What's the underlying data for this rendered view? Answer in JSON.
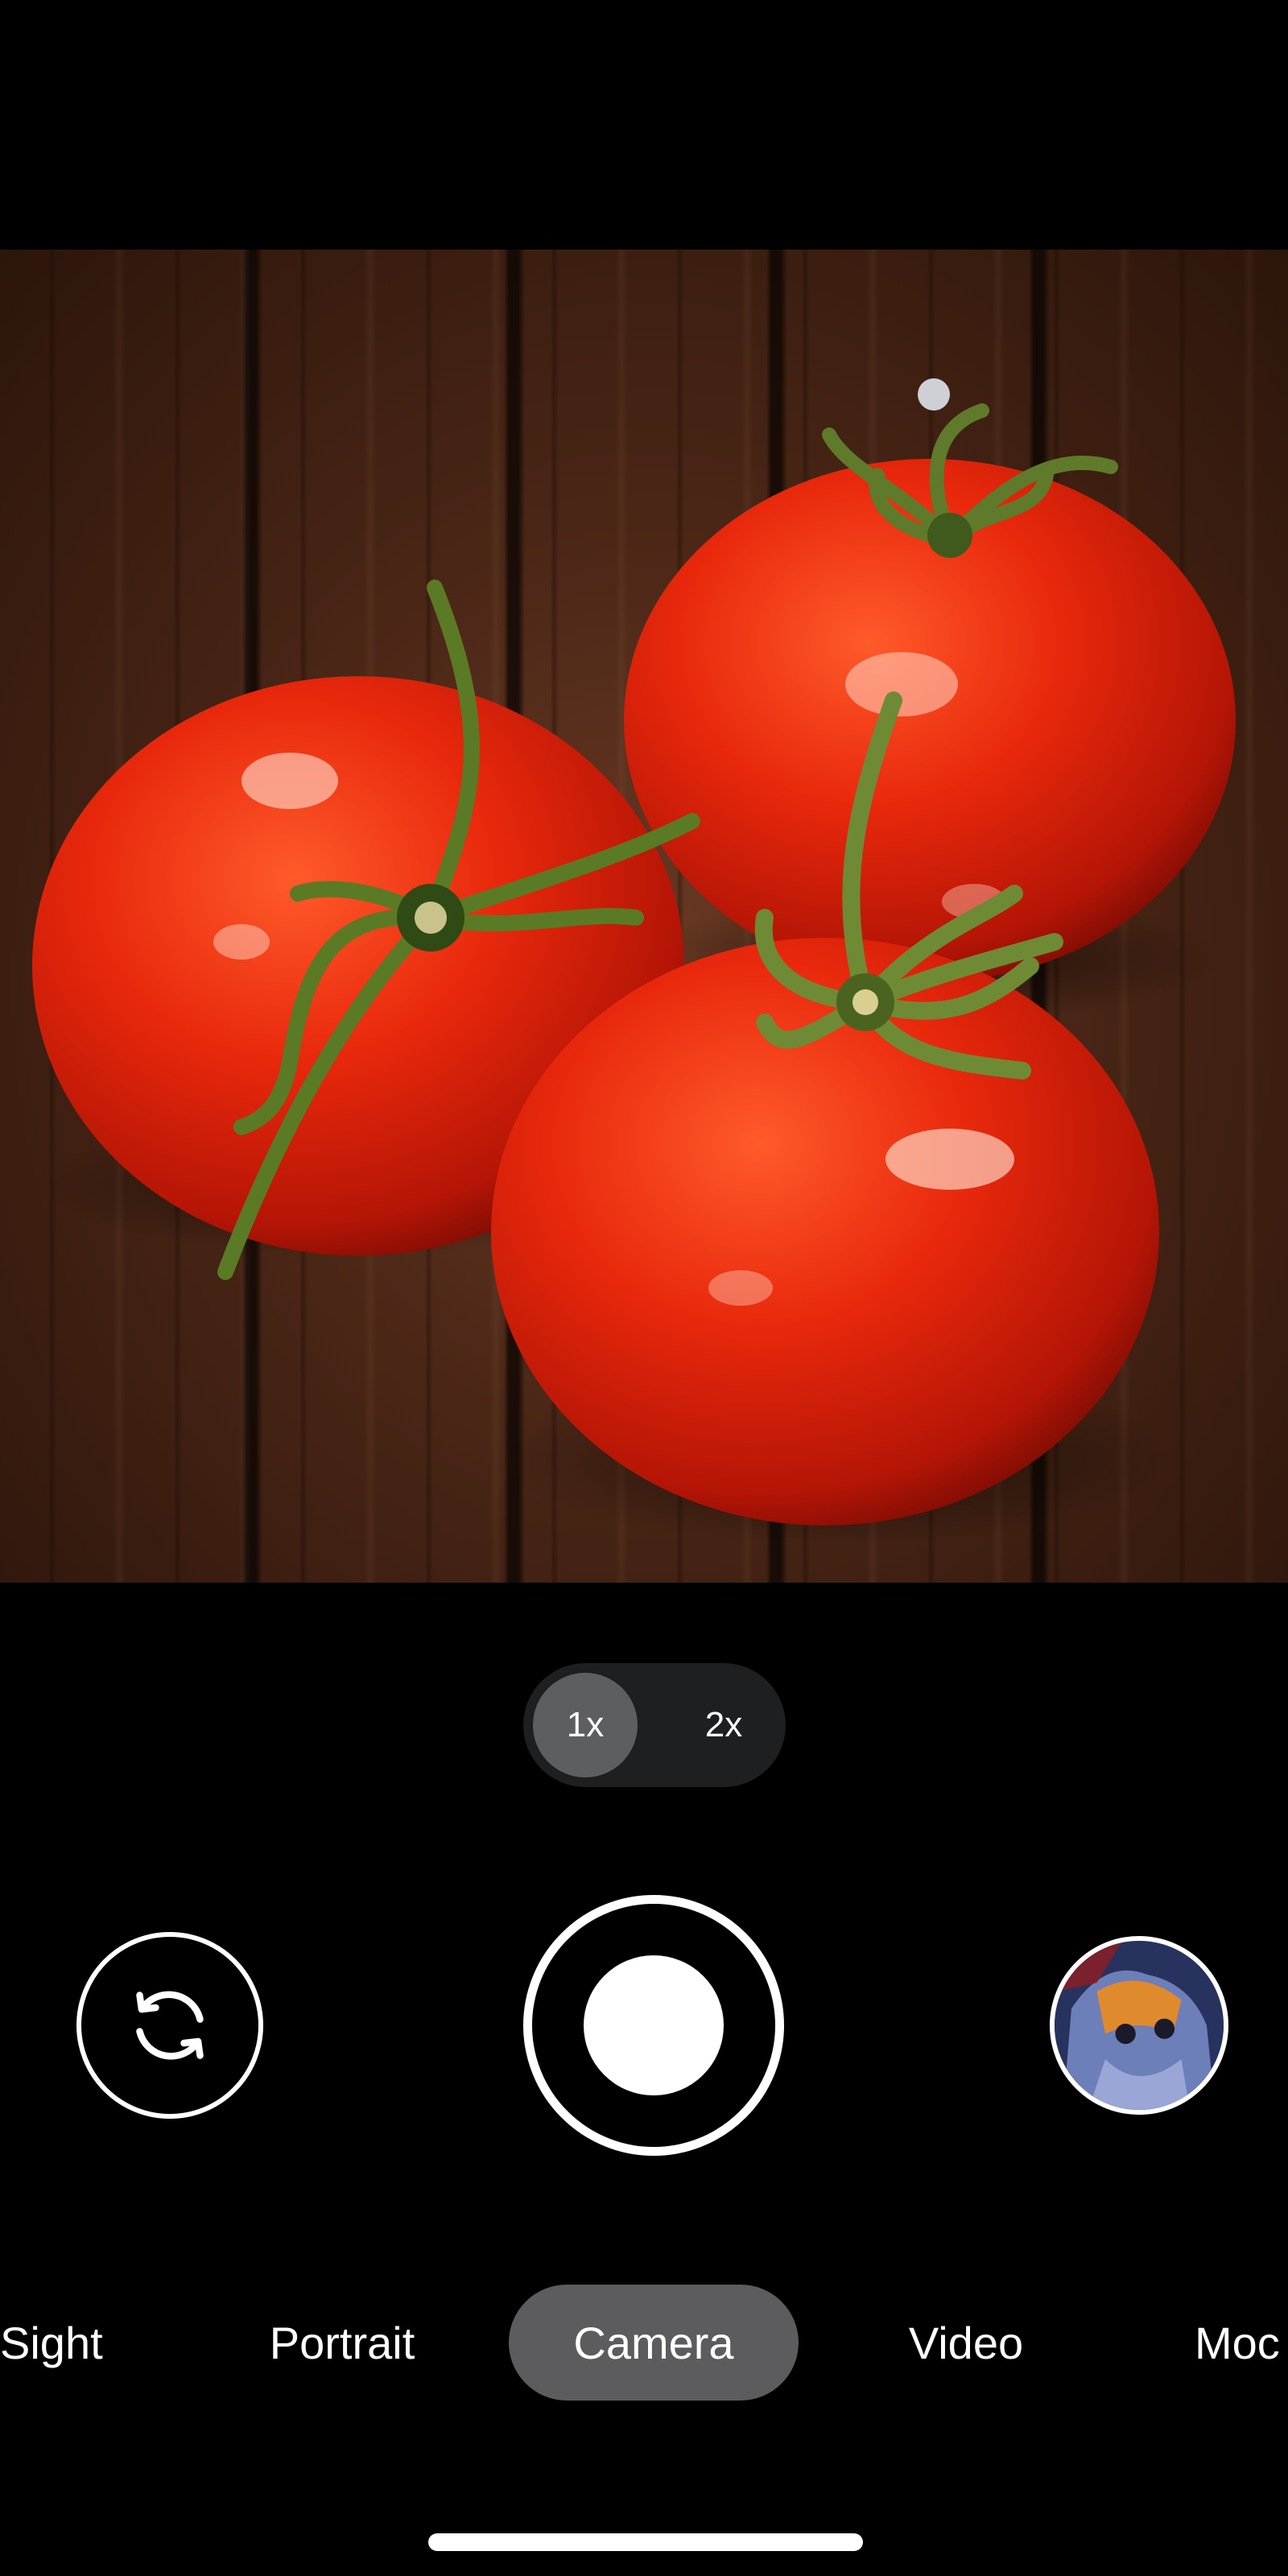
{
  "viewfinder": {
    "subject": "three red tomatoes on a wooden table"
  },
  "zoom": {
    "options": [
      "1x",
      "2x"
    ],
    "selected": "1x"
  },
  "controls": {
    "flip_icon": "flip-camera-icon",
    "shutter_icon": "shutter-icon",
    "thumbnail": "last-photo-thumbnail"
  },
  "modes": {
    "items": [
      "Sight",
      "Portrait",
      "Camera",
      "Video",
      "Moc"
    ],
    "selected": "Camera"
  },
  "colors": {
    "background": "#000000",
    "pill": "#1e1f21",
    "pill_active": "#5d5e60",
    "mode_active": "#5c5c5e",
    "accent": "#ffffff"
  }
}
